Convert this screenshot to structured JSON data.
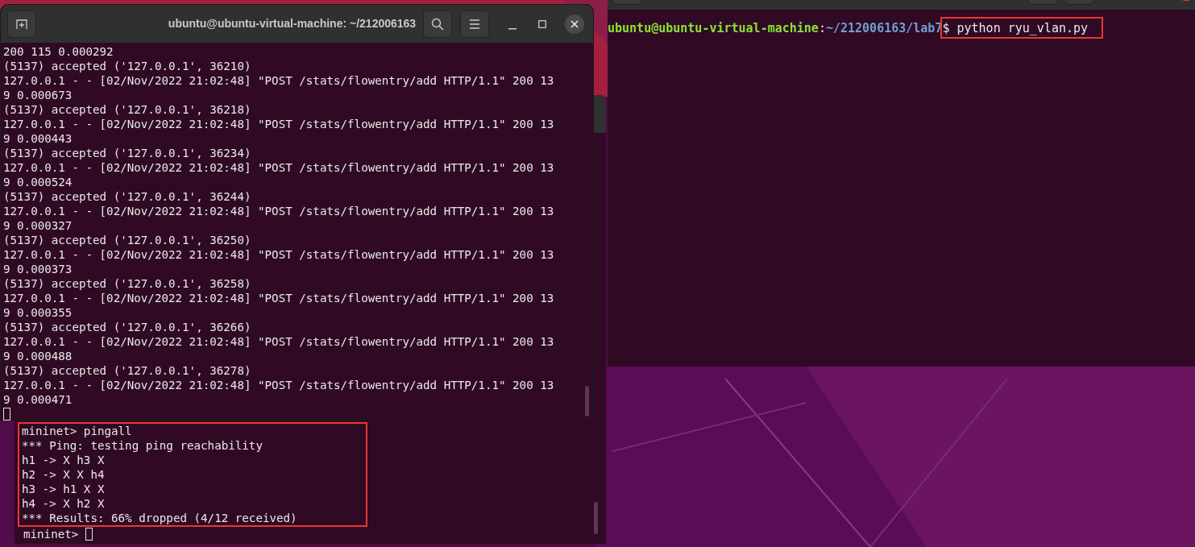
{
  "left_terminal": {
    "title": "ubuntu@ubuntu-virtual-machine: ~/212006163",
    "cursor": true,
    "lines": [
      "200 115 0.000292",
      "(5137) accepted ('127.0.0.1', 36210)",
      "127.0.0.1 - - [02/Nov/2022 21:02:48] \"POST /stats/flowentry/add HTTP/1.1\" 200 13",
      "9 0.000673",
      "(5137) accepted ('127.0.0.1', 36218)",
      "127.0.0.1 - - [02/Nov/2022 21:02:48] \"POST /stats/flowentry/add HTTP/1.1\" 200 13",
      "9 0.000443",
      "(5137) accepted ('127.0.0.1', 36234)",
      "127.0.0.1 - - [02/Nov/2022 21:02:48] \"POST /stats/flowentry/add HTTP/1.1\" 200 13",
      "9 0.000524",
      "(5137) accepted ('127.0.0.1', 36244)",
      "127.0.0.1 - - [02/Nov/2022 21:02:48] \"POST /stats/flowentry/add HTTP/1.1\" 200 13",
      "9 0.000327",
      "(5137) accepted ('127.0.0.1', 36250)",
      "127.0.0.1 - - [02/Nov/2022 21:02:48] \"POST /stats/flowentry/add HTTP/1.1\" 200 13",
      "9 0.000373",
      "(5137) accepted ('127.0.0.1', 36258)",
      "127.0.0.1 - - [02/Nov/2022 21:02:48] \"POST /stats/flowentry/add HTTP/1.1\" 200 13",
      "9 0.000355",
      "(5137) accepted ('127.0.0.1', 36266)",
      "127.0.0.1 - - [02/Nov/2022 21:02:48] \"POST /stats/flowentry/add HTTP/1.1\" 200 13",
      "9 0.000488",
      "(5137) accepted ('127.0.0.1', 36278)",
      "127.0.0.1 - - [02/Nov/2022 21:02:48] \"POST /stats/flowentry/add HTTP/1.1\" 200 13",
      "9 0.000471"
    ]
  },
  "right_terminal": {
    "user": "ubuntu@ubuntu-virtual-machine",
    "separator": ":",
    "path": "~/212006163/lab7",
    "command": "$ python ryu_vlan.py",
    "highlighted": true
  },
  "bottom_terminal": {
    "highlighted": true,
    "cursor": true,
    "prompt": "mininet>",
    "lines": [
      "mininet> pingall",
      "*** Ping: testing ping reachability",
      "h1 -> X h3 X",
      "h2 -> X X h4",
      "h3 -> h1 X X",
      "h4 -> X h2 X",
      "*** Results: 66% dropped (4/12 received)"
    ]
  }
}
